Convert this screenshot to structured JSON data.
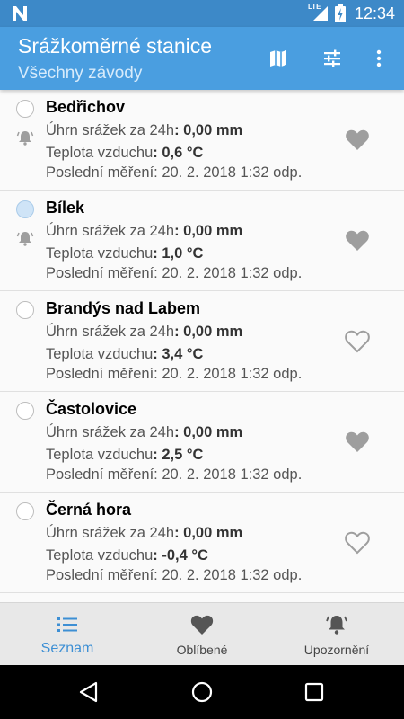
{
  "status_bar": {
    "time": "12:34",
    "network": "LTE"
  },
  "app_bar": {
    "title": "Srážkoměrné stanice",
    "subtitle": "Všechny závody",
    "actions": [
      "map-icon",
      "tune-icon",
      "more-vert-icon"
    ]
  },
  "labels": {
    "precip": "Úhrn srážek za 24h",
    "temp": "Teplota vzduchu",
    "last": "Poslední měření"
  },
  "stations": [
    {
      "name": "Bedřichov",
      "precip": ": 0,00 mm",
      "temp": ": 0,6 °C",
      "last": ": 20. 2. 2018 1:32 odp.",
      "selected": false,
      "alert": true,
      "favorite": true
    },
    {
      "name": "Bílek",
      "precip": ": 0,00 mm",
      "temp": ": 1,0 °C",
      "last": ": 20. 2. 2018 1:32 odp.",
      "selected": true,
      "alert": true,
      "favorite": true
    },
    {
      "name": "Brandýs nad Labem",
      "precip": ": 0,00 mm",
      "temp": ": 3,4 °C",
      "last": ": 20. 2. 2018 1:32 odp.",
      "selected": false,
      "alert": false,
      "favorite": false
    },
    {
      "name": "Častolovice",
      "precip": ": 0,00 mm",
      "temp": ": 2,5 °C",
      "last": ": 20. 2. 2018 1:32 odp.",
      "selected": false,
      "alert": false,
      "favorite": true
    },
    {
      "name": "Černá hora",
      "precip": ": 0,00 mm",
      "temp": ": -0,4 °C",
      "last": ": 20. 2. 2018 1:32 odp.",
      "selected": false,
      "alert": false,
      "favorite": false
    }
  ],
  "bottom_nav": [
    {
      "label": "Seznam",
      "icon": "list-icon",
      "active": true
    },
    {
      "label": "Oblíbené",
      "icon": "heart-icon",
      "active": false
    },
    {
      "label": "Upozornění",
      "icon": "bell-icon",
      "active": false
    }
  ],
  "colors": {
    "primary": "#4a9ee0",
    "primary_dark": "#3d89c8",
    "accent": "#3d8fd4",
    "heart": "#9e9e9e"
  }
}
